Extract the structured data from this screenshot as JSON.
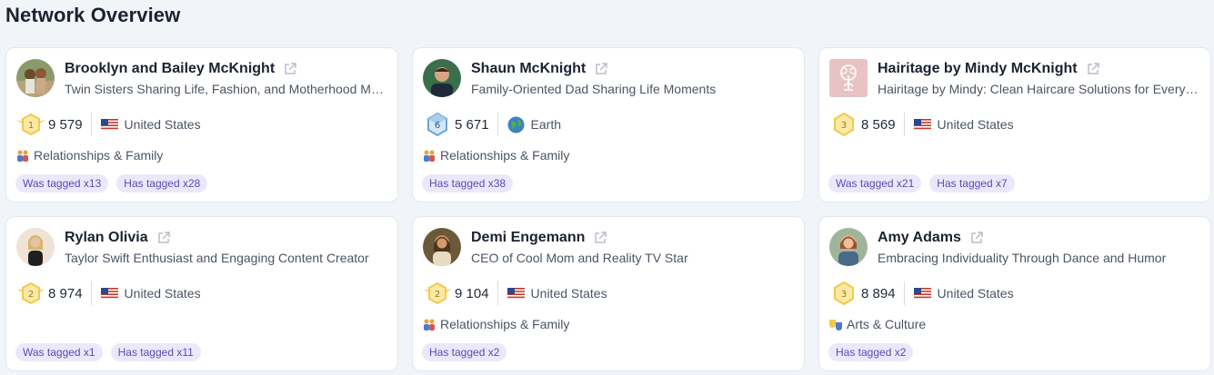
{
  "page": {
    "title": "Network Overview"
  },
  "colors": {
    "accent": "#5b4bb5",
    "tag_bg": "#ebe8fb",
    "gold": "#f2c94c",
    "blue_badge": "#6aa6d8"
  },
  "cards": [
    {
      "name": "Brooklyn and Bailey McKnight",
      "description": "Twin Sisters Sharing Life, Fashion, and Motherhood Moments",
      "avatar": "avatar-photo",
      "level": "1",
      "level_style": "gold-winged",
      "followers": "9 579",
      "location_icon": "us-flag-icon",
      "location": "United States",
      "category_icon": "family-icon",
      "category": "Relationships & Family",
      "tags": [
        "Was tagged x13",
        "Has tagged x28"
      ]
    },
    {
      "name": "Shaun McKnight",
      "description": "Family-Oriented Dad Sharing Life Moments",
      "avatar": "avatar-photo",
      "level": "6",
      "level_style": "blue-gem",
      "followers": "5 671",
      "location_icon": "globe-icon",
      "location": "Earth",
      "category_icon": "family-icon",
      "category": "Relationships & Family",
      "tags": [
        "Has tagged x38"
      ]
    },
    {
      "name": "Hairitage by Mindy McKnight",
      "description": "Hairitage by Mindy: Clean Haircare Solutions for Every Hair Type",
      "avatar": "logo-tree",
      "level": "3",
      "level_style": "gold-hex",
      "followers": "8 569",
      "location_icon": "us-flag-icon",
      "location": "United States",
      "category_icon": "",
      "category": "",
      "tags": [
        "Was tagged x21",
        "Has tagged x7"
      ]
    },
    {
      "name": "Rylan Olivia",
      "description": "Taylor Swift Enthusiast and Engaging Content Creator",
      "avatar": "avatar-photo",
      "level": "2",
      "level_style": "gold-winged",
      "followers": "8 974",
      "location_icon": "us-flag-icon",
      "location": "United States",
      "category_icon": "",
      "category": "",
      "tags": [
        "Was tagged x1",
        "Has tagged x11"
      ]
    },
    {
      "name": "Demi Engemann",
      "description": "CEO of Cool Mom and Reality TV Star",
      "avatar": "avatar-photo",
      "level": "2",
      "level_style": "gold-winged",
      "followers": "9 104",
      "location_icon": "us-flag-icon",
      "location": "United States",
      "category_icon": "family-icon",
      "category": "Relationships & Family",
      "tags": [
        "Has tagged x2"
      ]
    },
    {
      "name": "Amy Adams",
      "description": "Embracing Individuality Through Dance and Humor",
      "avatar": "avatar-photo",
      "level": "3",
      "level_style": "gold-hex",
      "followers": "8 894",
      "location_icon": "us-flag-icon",
      "location": "United States",
      "category_icon": "theater-masks-icon",
      "category": "Arts & Culture",
      "tags": [
        "Has tagged x2"
      ]
    }
  ]
}
